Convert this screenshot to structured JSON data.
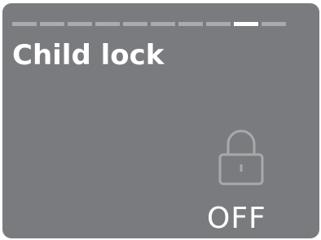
{
  "pager": {
    "total_pages": 10,
    "active_page": 9
  },
  "screen": {
    "title": "Child lock",
    "icon": "lock-icon",
    "state": "OFF"
  },
  "colors": {
    "background": "#7a7b7e",
    "text": "#ffffff",
    "pager_inactive": "#aaabad",
    "pager_active": "#ffffff",
    "icon_stroke": "#a8a9ab"
  }
}
